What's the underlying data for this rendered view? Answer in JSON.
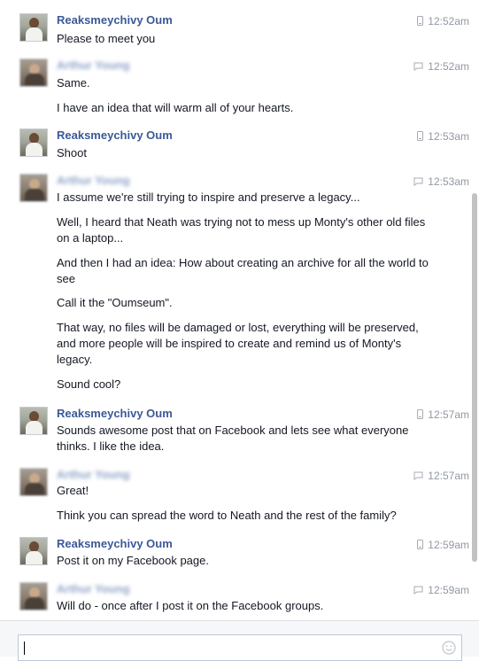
{
  "messages": [
    {
      "sender": "Reaksmeychivy Oum",
      "avatar": "person-avatar",
      "device": "mobile-icon",
      "time": "12:52am",
      "lines": [
        "Please to meet you"
      ]
    },
    {
      "sender": "Arthur Young",
      "avatar": "person-avatar",
      "device": "chat-icon",
      "time": "12:52am",
      "lines": [
        "Same.",
        "I have an idea that will warm all of your hearts."
      ]
    },
    {
      "sender": "Reaksmeychivy Oum",
      "avatar": "person-avatar",
      "device": "mobile-icon",
      "time": "12:53am",
      "lines": [
        "Shoot"
      ]
    },
    {
      "sender": "Arthur Young",
      "avatar": "person-avatar",
      "device": "chat-icon",
      "time": "12:53am",
      "lines": [
        "I assume we're still trying to inspire and preserve a legacy...",
        "Well, I heard that Neath was trying not to mess up Monty's other old files on a laptop...",
        "And then I had an idea: How about creating an archive for all the world to see",
        "Call it the \"Oumseum\".",
        "That way, no files will be damaged or lost, everything will be preserved, and more people will be inspired to create and remind us of Monty's legacy.",
        "Sound cool?"
      ]
    },
    {
      "sender": "Reaksmeychivy Oum",
      "avatar": "person-avatar",
      "device": "mobile-icon",
      "time": "12:57am",
      "lines": [
        "Sounds awesome post that on Facebook and lets see what everyone thinks. I like the idea."
      ]
    },
    {
      "sender": "Arthur Young",
      "avatar": "person-avatar",
      "device": "chat-icon",
      "time": "12:57am",
      "lines": [
        "Great!",
        "Think you can spread the word to Neath and the rest of the family?"
      ]
    },
    {
      "sender": "Reaksmeychivy Oum",
      "avatar": "person-avatar",
      "device": "mobile-icon",
      "time": "12:59am",
      "lines": [
        "Post it on my Facebook page."
      ]
    },
    {
      "sender": "Arthur Young",
      "avatar": "person-avatar",
      "device": "chat-icon",
      "time": "12:59am",
      "lines": [
        "Will do - once after I post it on the Facebook groups."
      ]
    }
  ],
  "composer": {
    "value": "",
    "emoji_icon": "smiley-icon"
  },
  "colors": {
    "sender_name": "#3b5998",
    "timestamp": "#9197a3",
    "text": "#141823"
  }
}
